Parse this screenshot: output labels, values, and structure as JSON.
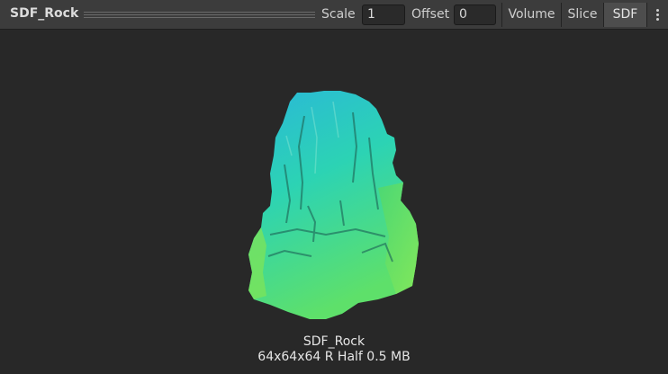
{
  "toolbar": {
    "asset_name": "SDF_Rock",
    "scale_label": "Scale",
    "scale_value": "1",
    "offset_label": "Offset",
    "offset_value": "0",
    "modes": [
      "Volume",
      "Slice",
      "SDF"
    ],
    "active_mode": "SDF",
    "more_icon": "kebab-menu-icon"
  },
  "preview": {
    "asset_name": "SDF_Rock",
    "description": "64x64x64 R Half 0.5 MB"
  },
  "colors": {
    "toolbar_bg": "#3c3c3c",
    "preview_bg": "#282828",
    "rock_top": "#2ab8d8",
    "rock_bottom": "#5ee06a"
  }
}
